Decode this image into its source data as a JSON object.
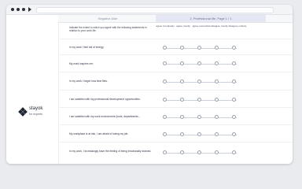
{
  "topbar": {
    "left_tab": "Negative Aide",
    "right_tab": "2. Professional life, Page 1 / 1"
  },
  "brand": {
    "name": "stayok",
    "tagline": "for experts"
  },
  "survey": {
    "instructions": "Indicate the extent to which you agree with the following statements in relation to your work life.",
    "scale_labels": [
      "agree completely",
      "agree mostly",
      "agree somewhat",
      "disagree mostly",
      "disagree entirely"
    ],
    "questions": [
      {
        "text": "In my work I feel full of energy."
      },
      {
        "text": "My work inspires me."
      },
      {
        "text": "In my work I forget how time flies."
      },
      {
        "text": "I am satisfied with my professional development opportunities."
      },
      {
        "text": "I am satisfied with my work environment (tools, departments..."
      },
      {
        "text": "My workplace is at risk, I am afraid of losing my job."
      },
      {
        "text": "In my work, I increasingly have the feeling of being emotionally drained."
      }
    ]
  }
}
